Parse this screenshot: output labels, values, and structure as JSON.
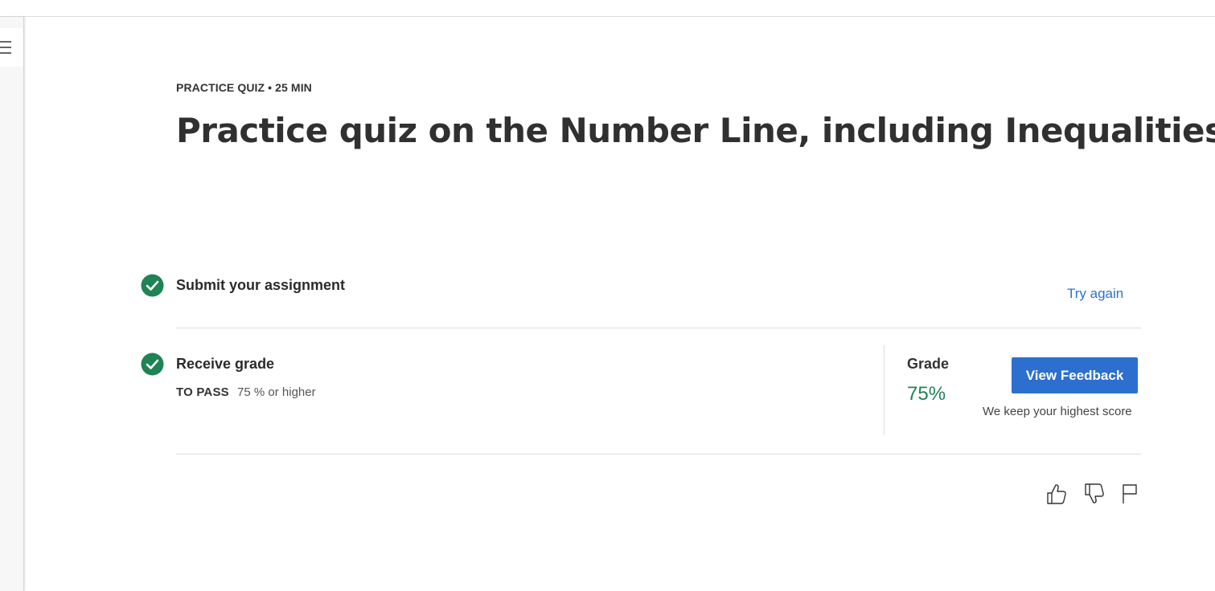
{
  "quiz": {
    "eyebrow": "PRACTICE QUIZ • 25 MIN",
    "title": "Practice quiz on the Number Line, including Inequalities"
  },
  "steps": {
    "submit": {
      "title": "Submit your assignment",
      "action_label": "Try again"
    },
    "grade": {
      "title": "Receive grade",
      "pass_label": "TO PASS",
      "pass_value": "75 % or higher",
      "grade_label": "Grade",
      "grade_value": "75%",
      "feedback_button": "View Feedback",
      "note": "We keep your highest score"
    }
  },
  "icons": {
    "menu": "menu-icon",
    "completed": "check-circle-icon",
    "like": "thumbs-up-icon",
    "dislike": "thumbs-down-icon",
    "report": "flag-icon"
  },
  "colors": {
    "success": "#1f8354",
    "link": "#2a73cc",
    "primary_button": "#2d6fcf",
    "text": "#303030"
  }
}
